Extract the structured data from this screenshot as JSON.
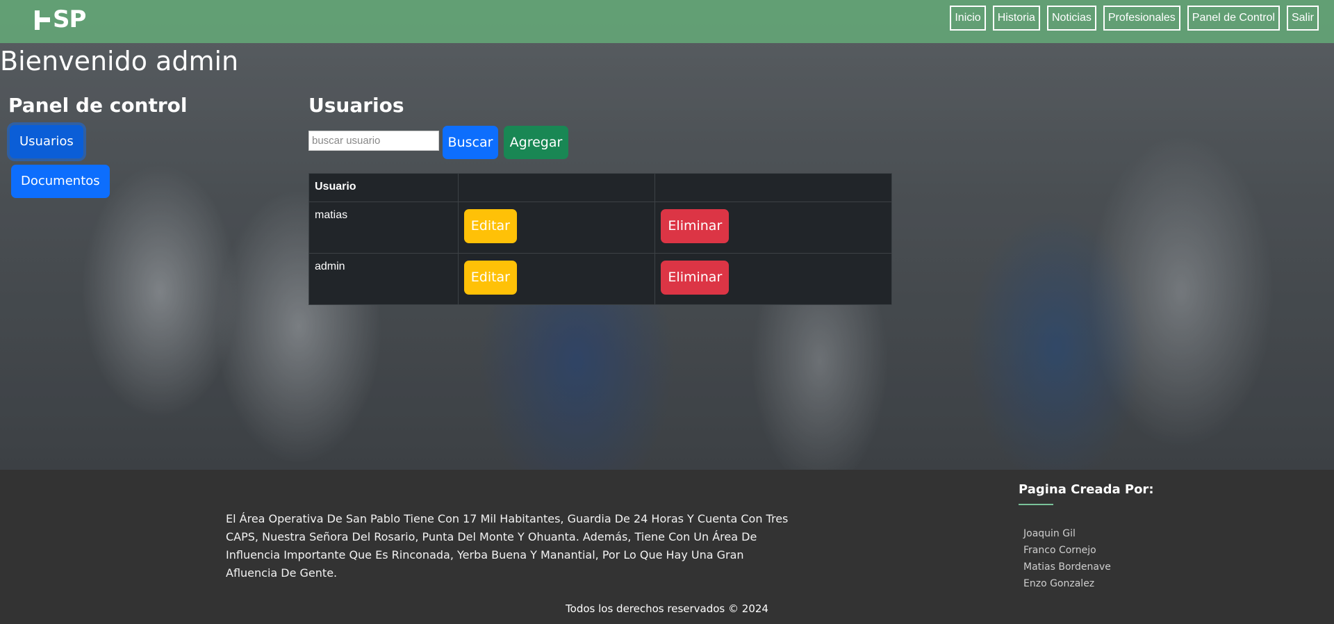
{
  "header": {
    "logo_text": "SP",
    "nav": [
      "Inicio",
      "Historia",
      "Noticias",
      "Profesionales",
      "Panel de Control",
      "Salir"
    ]
  },
  "welcome": "Bienvenido admin",
  "sidebar": {
    "title": "Panel de control",
    "items": [
      "Usuarios",
      "Documentos"
    ]
  },
  "users": {
    "title": "Usuarios",
    "search_placeholder": "buscar usuario",
    "search_button": "Buscar",
    "add_button": "Agregar",
    "table": {
      "headers": [
        "Usuario",
        "",
        ""
      ],
      "rows": [
        {
          "username": "matias",
          "edit": "Editar",
          "delete": "Eliminar"
        },
        {
          "username": "admin",
          "edit": "Editar",
          "delete": "Eliminar"
        }
      ]
    }
  },
  "footer": {
    "about": "El Área Operativa De San Pablo Tiene Con 17 Mil Habitantes, Guardia De 24 Horas Y Cuenta Con Tres CAPS, Nuestra Señora Del Rosario, Punta Del Monte Y Ohuanta. Además, Tiene Con Un Área De Influencia Importante Que Es Rinconada, Yerba Buena Y Manantial, Por Lo Que Hay Una Gran Afluencia De Gente.",
    "credits_title": "Pagina Creada Por:",
    "credits": [
      "Joaquin Gil",
      "Franco Cornejo",
      "Matias Bordenave",
      "Enzo Gonzalez"
    ],
    "copyright": "Todos los derechos reservados © 2024"
  },
  "colors": {
    "navbar": "#64aa78",
    "primary": "#0d6efd",
    "success": "#198754",
    "warning": "#ffc107",
    "danger": "#dc3545",
    "table_bg": "#212529",
    "footer_bg": "#333333"
  }
}
